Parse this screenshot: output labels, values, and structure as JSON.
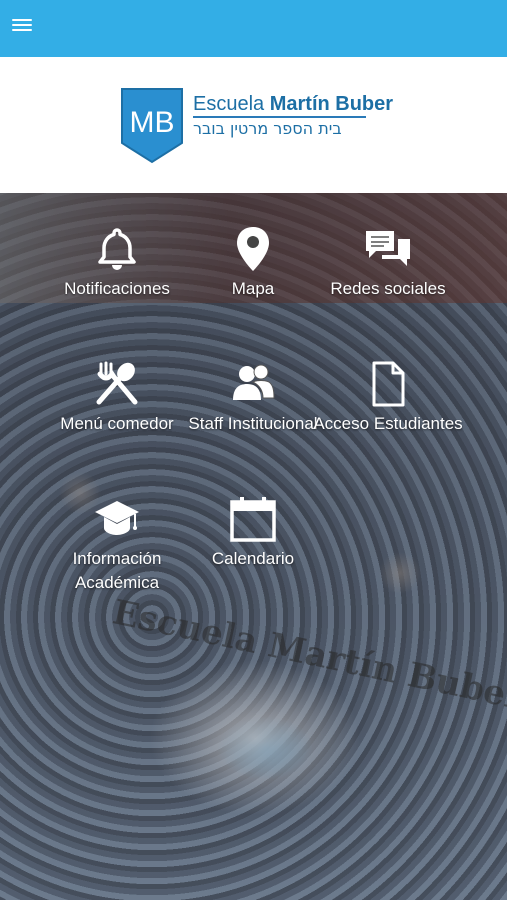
{
  "header": {
    "menu_icon": "hamburger-menu-icon",
    "bar_color": "#33aee6"
  },
  "logo": {
    "crest_text": "MB",
    "title_prefix": "Escuela",
    "title_name": "Martín Buber",
    "hebrew_name": "בית הספר מרטין בובר",
    "brand_color": "#2a8fd0"
  },
  "hero": {
    "floor_text": "Escuela Martín Buber"
  },
  "menu": {
    "items": [
      {
        "label": "Notificaciones",
        "icon": "bell-icon"
      },
      {
        "label": "Mapa",
        "icon": "map-pin-icon"
      },
      {
        "label": "Redes sociales",
        "icon": "chat-bubbles-icon"
      },
      {
        "label": "Menú comedor",
        "icon": "fork-spoon-icon"
      },
      {
        "label": "Staff Institucional",
        "icon": "people-icon"
      },
      {
        "label": "Acceso Estudiantes",
        "icon": "document-icon"
      },
      {
        "label": "Información Académica",
        "icon": "graduation-cap-icon"
      },
      {
        "label": "Calendario",
        "icon": "calendar-icon"
      }
    ]
  }
}
